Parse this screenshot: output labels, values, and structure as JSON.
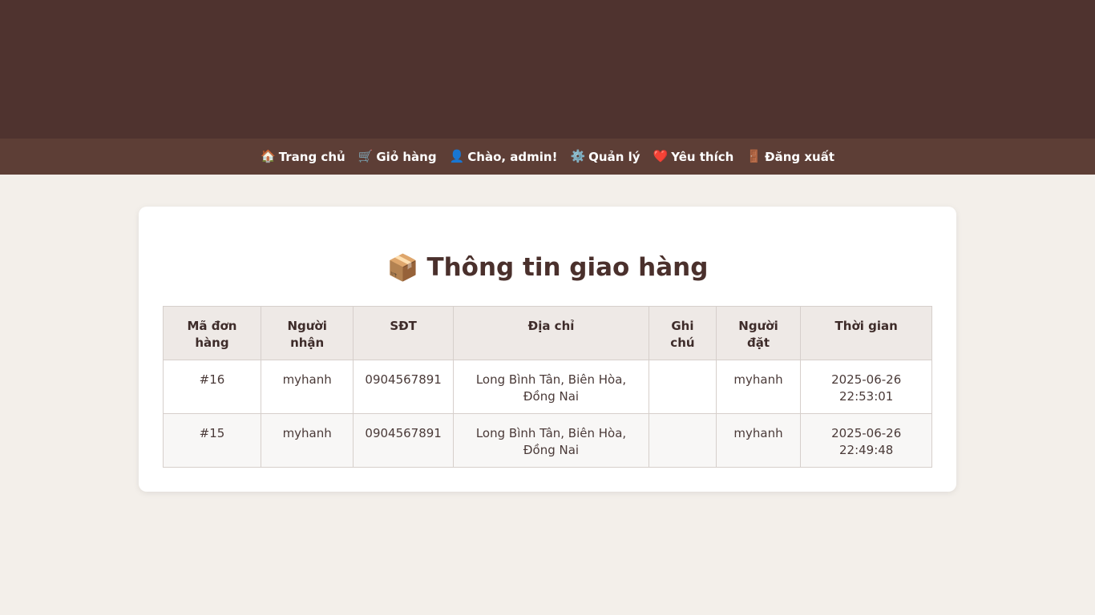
{
  "nav": {
    "items": [
      {
        "icon": "🏠",
        "label": "Trang chủ"
      },
      {
        "icon": "🛒",
        "label": "Giỏ hàng"
      },
      {
        "icon": "👤",
        "label": "Chào, admin!"
      },
      {
        "icon": "⚙️",
        "label": "Quản lý"
      },
      {
        "icon": "❤️",
        "label": "Yêu thích"
      },
      {
        "icon": "🚪",
        "label": "Đăng xuất"
      }
    ]
  },
  "page": {
    "title_icon": "📦",
    "title": "Thông tin giao hàng"
  },
  "table": {
    "headers": [
      "Mã đơn hàng",
      "Người nhận",
      "SĐT",
      "Địa chỉ",
      "Ghi chú",
      "Người đặt",
      "Thời gian"
    ],
    "rows": [
      {
        "id": "#16",
        "recipient": "myhanh",
        "phone": "0904567891",
        "address": "Long Bình Tân, Biên Hòa, Đồng Nai",
        "note": "",
        "orderer": "myhanh",
        "time": "2025-06-26 22:53:01"
      },
      {
        "id": "#15",
        "recipient": "myhanh",
        "phone": "0904567891",
        "address": "Long Bình Tân, Biên Hòa, Đồng Nai",
        "note": "",
        "orderer": "myhanh",
        "time": "2025-06-26 22:49:48"
      }
    ]
  },
  "colors": {
    "banner": "#4f332f",
    "navbar": "#5d3e36",
    "background": "#f3efea",
    "title": "#4a302c"
  }
}
